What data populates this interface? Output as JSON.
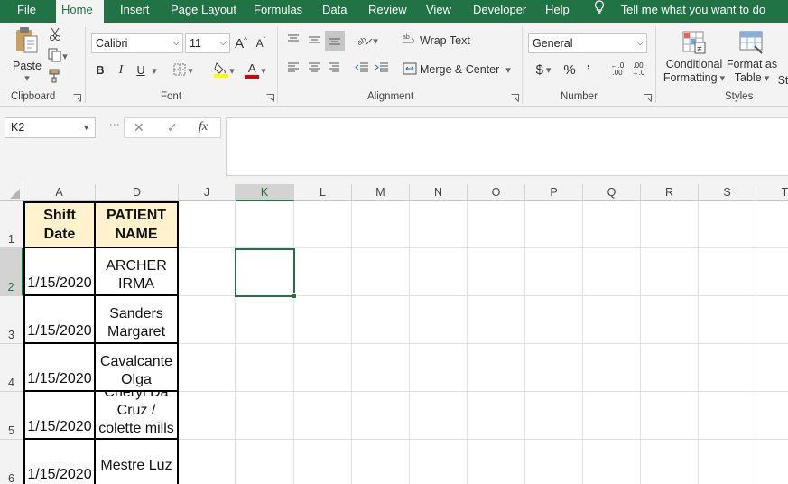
{
  "tabs": [
    "File",
    "Home",
    "Insert",
    "Page Layout",
    "Formulas",
    "Data",
    "Review",
    "View",
    "Developer",
    "Help"
  ],
  "active_tab": "Home",
  "tell_me": "Tell me what you want to do",
  "ribbon": {
    "clipboard": {
      "label": "Clipboard",
      "paste": "Paste"
    },
    "font": {
      "label": "Font",
      "name": "Calibri",
      "size": "11",
      "bold": "B",
      "italic": "I",
      "underline": "U",
      "grow": "A",
      "shrink": "A",
      "color_letter": "A"
    },
    "alignment": {
      "label": "Alignment",
      "wrap_text": "Wrap Text",
      "merge_center": "Merge & Center"
    },
    "number": {
      "label": "Number",
      "format": "General",
      "currency": "$",
      "percent": "%",
      "comma": "’",
      "inc_dec": "←.0\n.00",
      "dec_dec": ".00\n→.0"
    },
    "styles": {
      "label": "Styles",
      "conditional_1": "Conditional",
      "conditional_2": "Formatting",
      "format_as_1": "Format as",
      "format_as_2": "Table",
      "cell_styles": "St"
    }
  },
  "formula_bar": {
    "name_box": "K2",
    "cancel": "✕",
    "enter": "✓",
    "fx": "fx",
    "content": ""
  },
  "columns": [
    "A",
    "D",
    "J",
    "K",
    "L",
    "M",
    "N",
    "O",
    "P",
    "Q",
    "R",
    "S",
    "T"
  ],
  "selected_column": "K",
  "rows": [
    "1",
    "2",
    "3",
    "4",
    "5",
    "6"
  ],
  "selected_row": "2",
  "cells": {
    "A1": [
      "Shift",
      "Date"
    ],
    "D1": [
      "PATIENT",
      "NAME"
    ],
    "A2": "1/15/2020",
    "D2": [
      "ARCHER",
      "IRMA"
    ],
    "A3": "1/15/2020",
    "D3": [
      "Sanders",
      "Margaret"
    ],
    "A4": "1/15/2020",
    "D4": [
      "Cavalcante",
      "Olga"
    ],
    "A5": "1/15/2020",
    "D5": [
      "Cheryl Da",
      "Cruz /",
      "colette mills"
    ],
    "A6": "1/15/2020",
    "D6": "Mestre Luz"
  },
  "colors": {
    "excel_green": "#217346",
    "header_fill": "#fff2cc"
  }
}
